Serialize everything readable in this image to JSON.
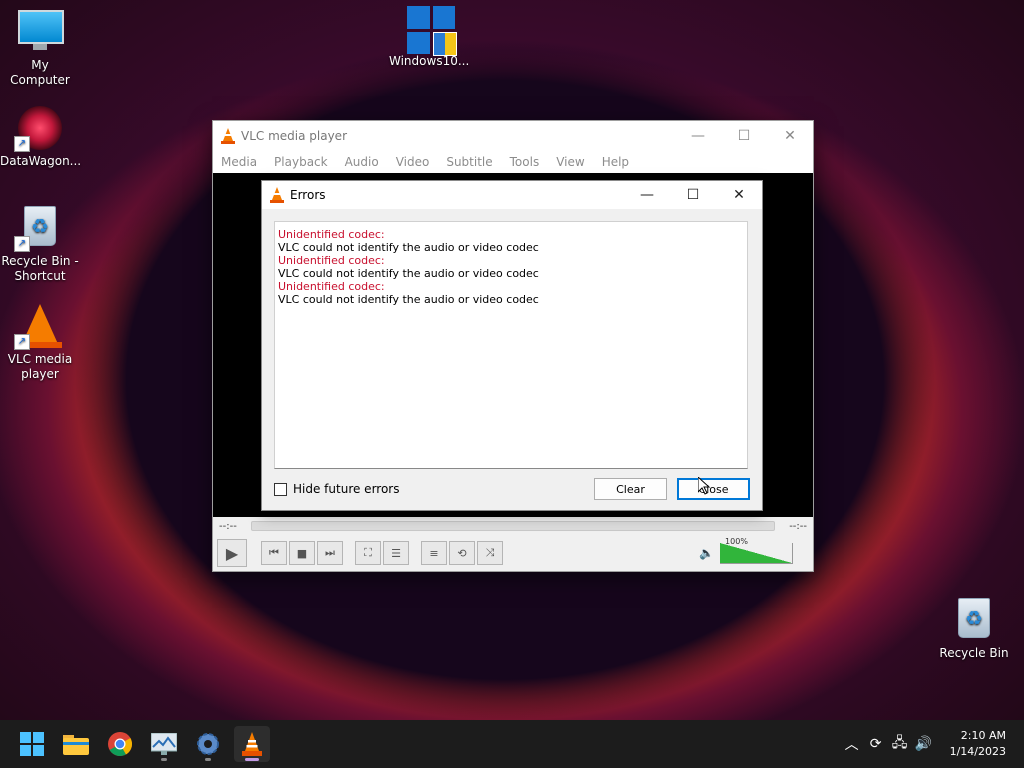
{
  "desktop": {
    "icons": [
      {
        "label": "My Computer"
      },
      {
        "label": "DataWagon..."
      },
      {
        "label": "Recycle Bin -\nShortcut"
      },
      {
        "label": "VLC media\nplayer"
      },
      {
        "label": "Windows10..."
      },
      {
        "label": "Recycle Bin"
      }
    ]
  },
  "vlc": {
    "title": "VLC media player",
    "menu": [
      "Media",
      "Playback",
      "Audio",
      "Video",
      "Subtitle",
      "Tools",
      "View",
      "Help"
    ],
    "time_elapsed": "--:--",
    "time_total": "--:--",
    "volume_label": "100%",
    "volume_level": 1.0
  },
  "errors_dialog": {
    "title": "Errors",
    "messages": [
      {
        "heading": "Unidentified codec:",
        "detail": "VLC could not identify the audio or video codec"
      },
      {
        "heading": "Unidentified codec:",
        "detail": "VLC could not identify the audio or video codec"
      },
      {
        "heading": "Unidentified codec:",
        "detail": "VLC could not identify the audio or video codec"
      }
    ],
    "hide_label": "Hide future errors",
    "hide_checked": false,
    "clear_label": "Clear",
    "close_label": "Close"
  },
  "taskbar": {
    "apps": [
      "start-icon",
      "file-explorer-icon",
      "chrome-icon",
      "photos-icon",
      "settings-icon",
      "vlc-icon"
    ],
    "active_app": "vlc-icon",
    "time": "2:10 AM",
    "date": "1/14/2023"
  },
  "colors": {
    "error_heading": "#c8102e",
    "accent": "#0078d7",
    "volume_green": "#31b53b"
  }
}
